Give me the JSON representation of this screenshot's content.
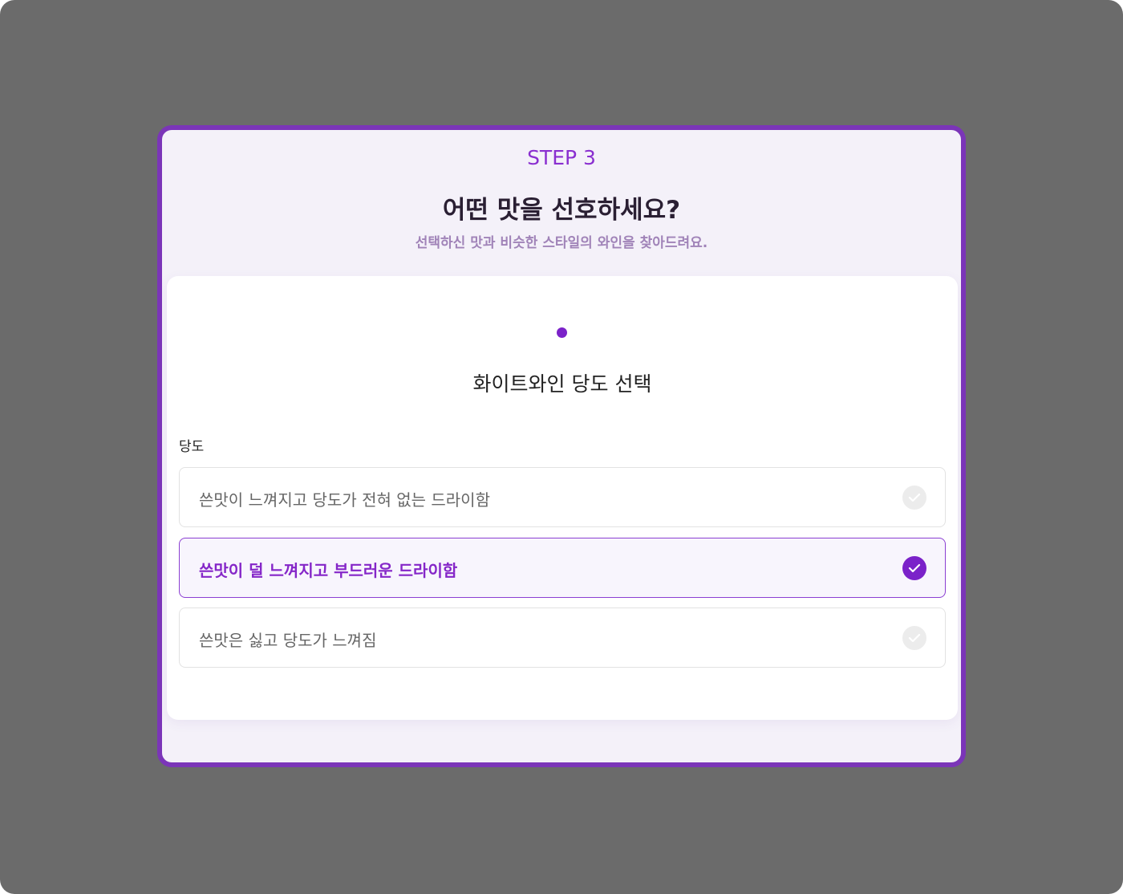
{
  "header": {
    "step": "STEP 3",
    "title": "어떤 맛을 선호하세요?",
    "subtitle": "선택하신 맛과 비슷한 스타일의 와인을 찾아드려요."
  },
  "card": {
    "title": "화이트와인 당도 선택",
    "field_label": "당도",
    "options": [
      {
        "label": "쓴맛이 느껴지고 당도가 전혀 없는 드라이함",
        "selected": false
      },
      {
        "label": "쓴맛이 덜 느껴지고 부드러운 드라이함",
        "selected": true
      },
      {
        "label": "쓴맛은 싫고 당도가 느껴짐",
        "selected": false
      }
    ]
  },
  "colors": {
    "accent": "#7b22c9",
    "border": "#7b35b8",
    "backdrop": "#6b6b6b"
  }
}
